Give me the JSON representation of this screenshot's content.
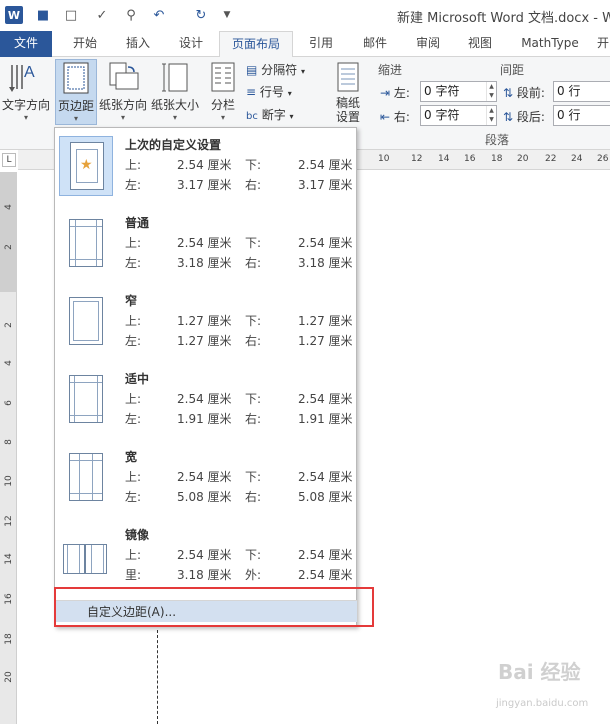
{
  "titlebar": {
    "title": "新建 Microsoft Word 文档.docx - Wo",
    "quick_access": [
      "word-logo",
      "save-icon",
      "new-doc-icon",
      "spelling-icon",
      "print-preview-icon",
      "undo-icon",
      "redo-icon",
      "customize-qat-icon"
    ]
  },
  "tabs": [
    "文件",
    "开始",
    "插入",
    "设计",
    "页面布局",
    "引用",
    "邮件",
    "审阅",
    "视图",
    "MathType",
    "开"
  ],
  "active_tab": "页面布局",
  "ribbon": {
    "text_direction": "文字方向",
    "margins": "页边距",
    "orientation": "纸张方向",
    "size": "纸张大小",
    "columns": "分栏",
    "breaks": "分隔符",
    "line_numbers": "行号",
    "hyphenation": "断字",
    "manuscript": "稿纸\n设置",
    "indent_label": "缩进",
    "spacing_label": "间距",
    "indent_left_label": "左:",
    "indent_left_value": "0 字符",
    "indent_right_label": "右:",
    "indent_right_value": "0 字符",
    "spacing_before_label": "段前:",
    "spacing_before_value": "0 行",
    "spacing_after_label": "段后:",
    "spacing_after_value": "0 行",
    "paragraph_group": "段落"
  },
  "ruler_numbers": [
    "10",
    "12",
    "14",
    "16",
    "18",
    "20",
    "22",
    "24",
    "26"
  ],
  "vruler_numbers": [
    "4",
    "2",
    "2",
    "4",
    "6",
    "8",
    "10",
    "12",
    "14",
    "16",
    "18",
    "20"
  ],
  "ruler_corner": "L",
  "margins_menu": {
    "presets": [
      {
        "name": "上次的自定义设置",
        "top_label": "上:",
        "top": "2.54 厘米",
        "bottom_label": "下:",
        "bottom": "2.54 厘米",
        "left_label": "左:",
        "left": "3.17 厘米",
        "right_label": "右:",
        "right": "3.17 厘米"
      },
      {
        "name": "普通",
        "top_label": "上:",
        "top": "2.54 厘米",
        "bottom_label": "下:",
        "bottom": "2.54 厘米",
        "left_label": "左:",
        "left": "3.18 厘米",
        "right_label": "右:",
        "right": "3.18 厘米"
      },
      {
        "name": "窄",
        "top_label": "上:",
        "top": "1.27 厘米",
        "bottom_label": "下:",
        "bottom": "1.27 厘米",
        "left_label": "左:",
        "left": "1.27 厘米",
        "right_label": "右:",
        "right": "1.27 厘米"
      },
      {
        "name": "适中",
        "top_label": "上:",
        "top": "2.54 厘米",
        "bottom_label": "下:",
        "bottom": "2.54 厘米",
        "left_label": "左:",
        "left": "1.91 厘米",
        "right_label": "右:",
        "right": "1.91 厘米"
      },
      {
        "name": "宽",
        "top_label": "上:",
        "top": "2.54 厘米",
        "bottom_label": "下:",
        "bottom": "2.54 厘米",
        "left_label": "左:",
        "left": "5.08 厘米",
        "right_label": "右:",
        "right": "5.08 厘米"
      },
      {
        "name": "镜像",
        "top_label": "上:",
        "top": "2.54 厘米",
        "bottom_label": "下:",
        "bottom": "2.54 厘米",
        "left_label": "里:",
        "left": "3.18 厘米",
        "right_label": "外:",
        "right": "2.54 厘米"
      }
    ],
    "custom": "自定义边距(A)..."
  },
  "watermark": "Bai 经验",
  "watermark_sub": "jingyan.baidu.com",
  "colors": {
    "accent": "#2b579a",
    "highlight": "#e43a3a",
    "menu_hover": "#d3e0f0"
  }
}
